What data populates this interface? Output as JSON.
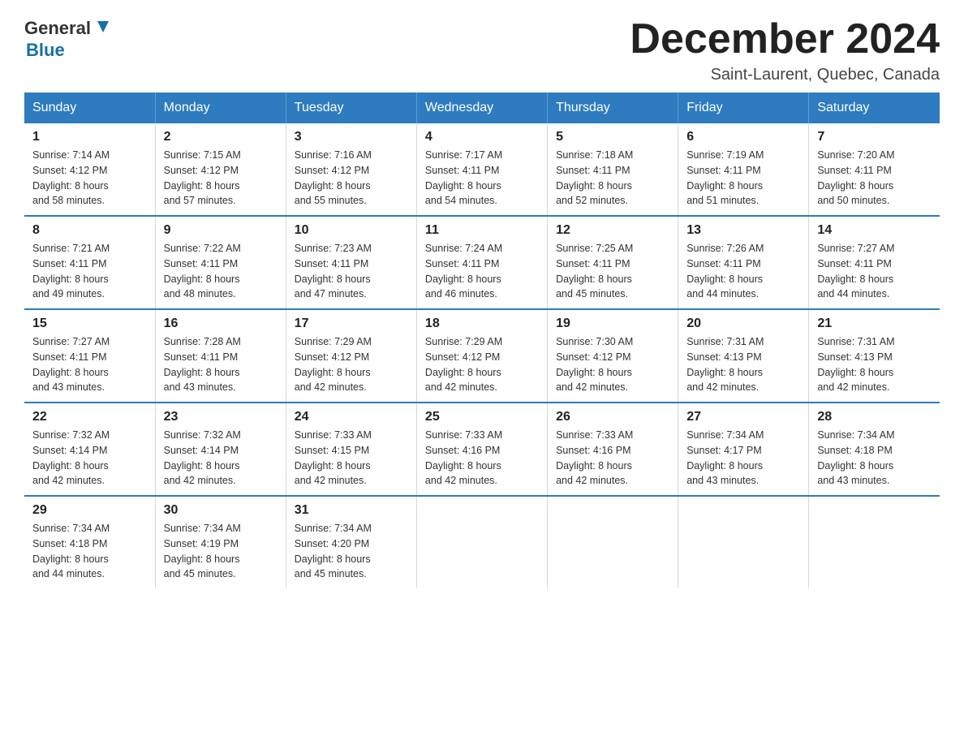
{
  "logo": {
    "general": "General",
    "blue": "Blue"
  },
  "title": "December 2024",
  "location": "Saint-Laurent, Quebec, Canada",
  "weekdays": [
    "Sunday",
    "Monday",
    "Tuesday",
    "Wednesday",
    "Thursday",
    "Friday",
    "Saturday"
  ],
  "weeks": [
    [
      {
        "day": "1",
        "sunrise": "7:14 AM",
        "sunset": "4:12 PM",
        "daylight": "8 hours and 58 minutes."
      },
      {
        "day": "2",
        "sunrise": "7:15 AM",
        "sunset": "4:12 PM",
        "daylight": "8 hours and 57 minutes."
      },
      {
        "day": "3",
        "sunrise": "7:16 AM",
        "sunset": "4:12 PM",
        "daylight": "8 hours and 55 minutes."
      },
      {
        "day": "4",
        "sunrise": "7:17 AM",
        "sunset": "4:11 PM",
        "daylight": "8 hours and 54 minutes."
      },
      {
        "day": "5",
        "sunrise": "7:18 AM",
        "sunset": "4:11 PM",
        "daylight": "8 hours and 52 minutes."
      },
      {
        "day": "6",
        "sunrise": "7:19 AM",
        "sunset": "4:11 PM",
        "daylight": "8 hours and 51 minutes."
      },
      {
        "day": "7",
        "sunrise": "7:20 AM",
        "sunset": "4:11 PM",
        "daylight": "8 hours and 50 minutes."
      }
    ],
    [
      {
        "day": "8",
        "sunrise": "7:21 AM",
        "sunset": "4:11 PM",
        "daylight": "8 hours and 49 minutes."
      },
      {
        "day": "9",
        "sunrise": "7:22 AM",
        "sunset": "4:11 PM",
        "daylight": "8 hours and 48 minutes."
      },
      {
        "day": "10",
        "sunrise": "7:23 AM",
        "sunset": "4:11 PM",
        "daylight": "8 hours and 47 minutes."
      },
      {
        "day": "11",
        "sunrise": "7:24 AM",
        "sunset": "4:11 PM",
        "daylight": "8 hours and 46 minutes."
      },
      {
        "day": "12",
        "sunrise": "7:25 AM",
        "sunset": "4:11 PM",
        "daylight": "8 hours and 45 minutes."
      },
      {
        "day": "13",
        "sunrise": "7:26 AM",
        "sunset": "4:11 PM",
        "daylight": "8 hours and 44 minutes."
      },
      {
        "day": "14",
        "sunrise": "7:27 AM",
        "sunset": "4:11 PM",
        "daylight": "8 hours and 44 minutes."
      }
    ],
    [
      {
        "day": "15",
        "sunrise": "7:27 AM",
        "sunset": "4:11 PM",
        "daylight": "8 hours and 43 minutes."
      },
      {
        "day": "16",
        "sunrise": "7:28 AM",
        "sunset": "4:11 PM",
        "daylight": "8 hours and 43 minutes."
      },
      {
        "day": "17",
        "sunrise": "7:29 AM",
        "sunset": "4:12 PM",
        "daylight": "8 hours and 42 minutes."
      },
      {
        "day": "18",
        "sunrise": "7:29 AM",
        "sunset": "4:12 PM",
        "daylight": "8 hours and 42 minutes."
      },
      {
        "day": "19",
        "sunrise": "7:30 AM",
        "sunset": "4:12 PM",
        "daylight": "8 hours and 42 minutes."
      },
      {
        "day": "20",
        "sunrise": "7:31 AM",
        "sunset": "4:13 PM",
        "daylight": "8 hours and 42 minutes."
      },
      {
        "day": "21",
        "sunrise": "7:31 AM",
        "sunset": "4:13 PM",
        "daylight": "8 hours and 42 minutes."
      }
    ],
    [
      {
        "day": "22",
        "sunrise": "7:32 AM",
        "sunset": "4:14 PM",
        "daylight": "8 hours and 42 minutes."
      },
      {
        "day": "23",
        "sunrise": "7:32 AM",
        "sunset": "4:14 PM",
        "daylight": "8 hours and 42 minutes."
      },
      {
        "day": "24",
        "sunrise": "7:33 AM",
        "sunset": "4:15 PM",
        "daylight": "8 hours and 42 minutes."
      },
      {
        "day": "25",
        "sunrise": "7:33 AM",
        "sunset": "4:16 PM",
        "daylight": "8 hours and 42 minutes."
      },
      {
        "day": "26",
        "sunrise": "7:33 AM",
        "sunset": "4:16 PM",
        "daylight": "8 hours and 42 minutes."
      },
      {
        "day": "27",
        "sunrise": "7:34 AM",
        "sunset": "4:17 PM",
        "daylight": "8 hours and 43 minutes."
      },
      {
        "day": "28",
        "sunrise": "7:34 AM",
        "sunset": "4:18 PM",
        "daylight": "8 hours and 43 minutes."
      }
    ],
    [
      {
        "day": "29",
        "sunrise": "7:34 AM",
        "sunset": "4:18 PM",
        "daylight": "8 hours and 44 minutes."
      },
      {
        "day": "30",
        "sunrise": "7:34 AM",
        "sunset": "4:19 PM",
        "daylight": "8 hours and 45 minutes."
      },
      {
        "day": "31",
        "sunrise": "7:34 AM",
        "sunset": "4:20 PM",
        "daylight": "8 hours and 45 minutes."
      },
      null,
      null,
      null,
      null
    ]
  ],
  "labels": {
    "sunrise": "Sunrise:",
    "sunset": "Sunset:",
    "daylight": "Daylight:"
  }
}
